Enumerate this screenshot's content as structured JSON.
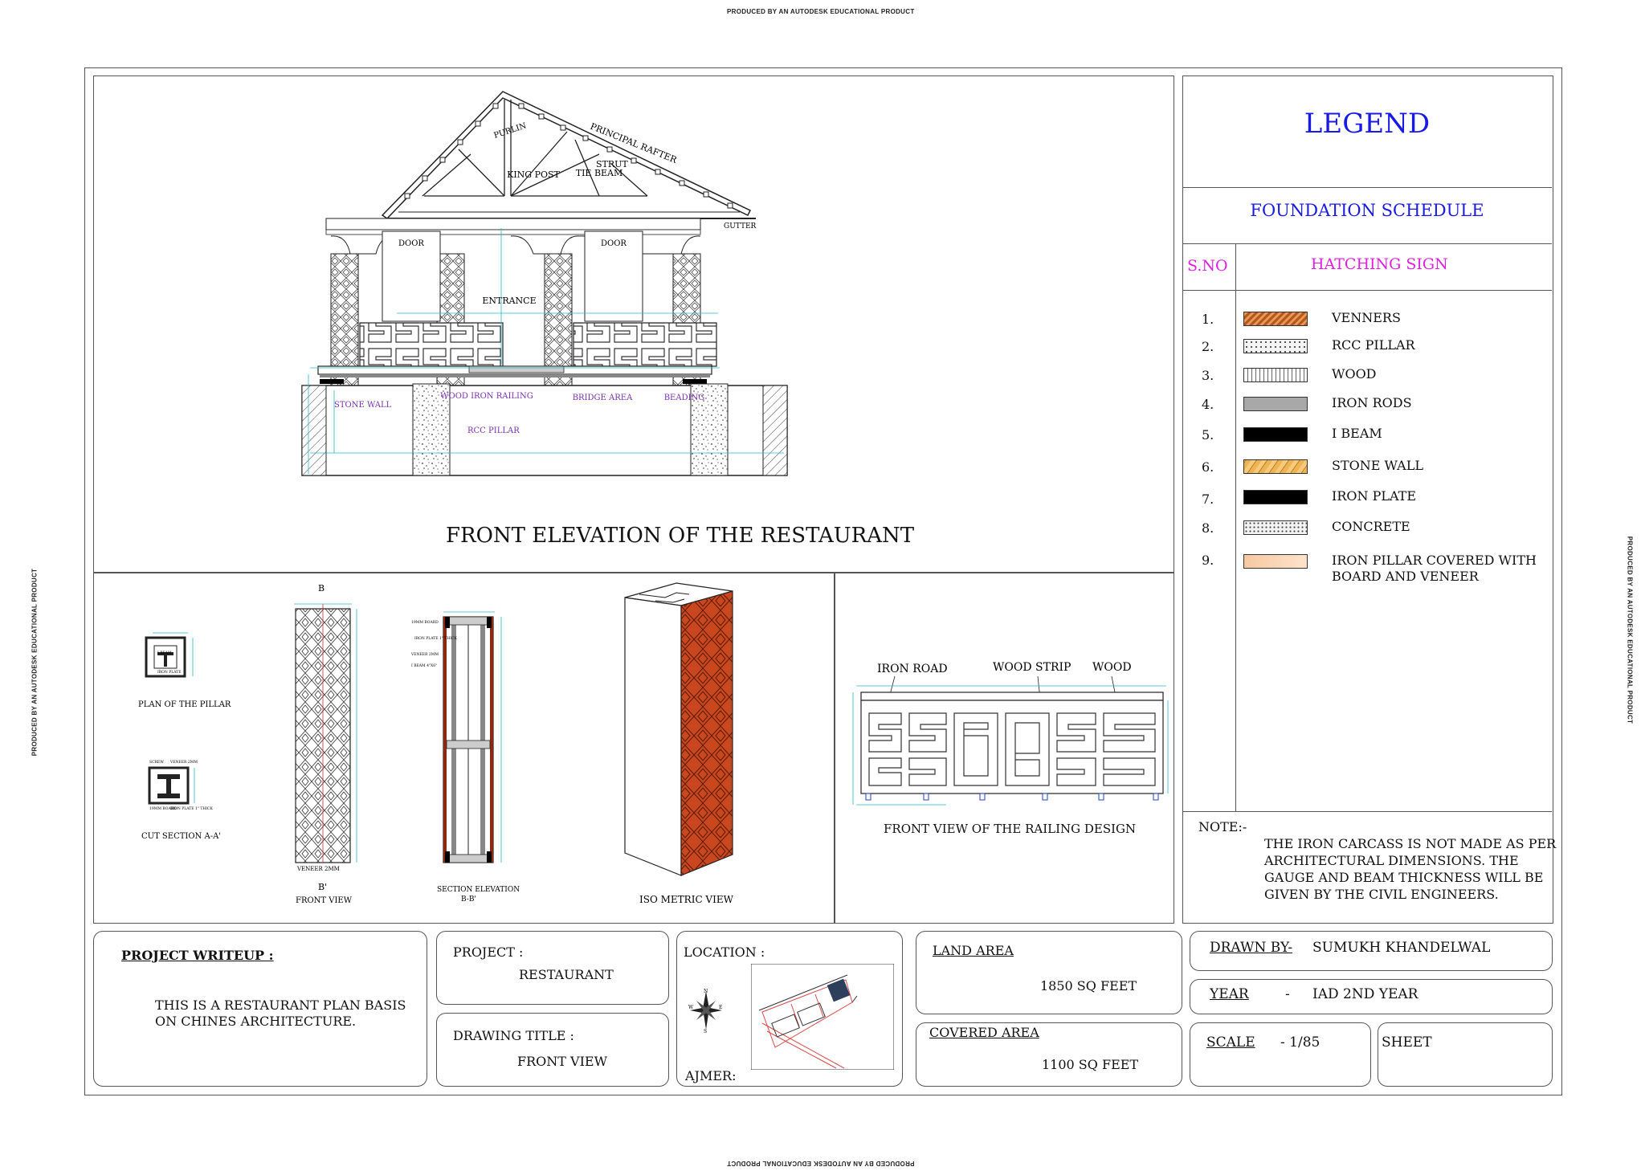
{
  "stamp": "PRODUCED BY AN AUTODESK EDUCATIONAL PRODUCT",
  "elevation": {
    "title": "FRONT ELEVATION OF THE  RESTAURANT",
    "labels": {
      "purlin": "PURLIN",
      "principal_rafter": "PRINCIPAL RAFTER",
      "tie_beam": "TIE BEAM",
      "king_post": "KING POST",
      "strut": "STRUT",
      "gutter": "GUTTER",
      "door_left": "DOOR",
      "door_right": "DOOR",
      "entrance": "ENTRANCE",
      "stone_wall": "STONE WALL",
      "wood_iron_railing": "WOOD IRON RAILING",
      "bridge_area": "BRIDGE AREA",
      "beading": "BEADING",
      "rcc_pillar": "RCC PILLAR"
    }
  },
  "details": {
    "plan_of_pillar": "PLAN OF THE PILLAR",
    "cut_section": "CUT SECTION A-A'",
    "front_view": "FRONT VIEW",
    "section_elevation_1": "SECTION ELEVATION",
    "section_elevation_2": "B-B'",
    "iso_view": "ISO METRIC VIEW",
    "veneer": "VENEER 2MM",
    "b_top": "B",
    "b_bottom": "B'",
    "plan_small": [
      "I BEAM",
      "IRON PLATE"
    ],
    "cut_small": [
      "SCREW",
      "VENEER 2MM",
      "19MM BOARD",
      "IRON PLATE 1\" THICK"
    ],
    "section_small": [
      "19MM BOARD",
      "IRON PLATE 1\" THICK",
      "VENEER 2MM",
      "I BEAM 4\"X6\""
    ]
  },
  "railing": {
    "title": "FRONT VIEW OF THE RAILING DESIGN",
    "iron_road": "IRON ROAD",
    "wood_strip": "WOOD STRIP",
    "wood": "WOOD"
  },
  "legend": {
    "title": "LEGEND",
    "subtitle": "FOUNDATION SCHEDULE",
    "col_sno": "S.NO",
    "col_hatch": "HATCHING SIGN",
    "items": [
      {
        "no": "1.",
        "name": "VENNERS",
        "swatch": "venners"
      },
      {
        "no": "2.",
        "name": "RCC PILLAR",
        "swatch": "rcc"
      },
      {
        "no": "3.",
        "name": "WOOD",
        "swatch": "wood"
      },
      {
        "no": "4.",
        "name": "IRON RODS",
        "swatch": "rods"
      },
      {
        "no": "5.",
        "name": "I BEAM",
        "swatch": "ibeam"
      },
      {
        "no": "6.",
        "name": "STONE WALL",
        "swatch": "stone"
      },
      {
        "no": "7.",
        "name": "IRON PLATE",
        "swatch": "plate"
      },
      {
        "no": "8.",
        "name": "CONCRETE",
        "swatch": "concrete"
      },
      {
        "no": "9.",
        "name": "IRON PILLAR COVERED WITH",
        "name2": "BOARD AND VENEER",
        "swatch": "pillar"
      }
    ],
    "colors": {
      "title": "#1a1ae6",
      "header": "#e020e0"
    },
    "note_label": "NOTE:-",
    "note_lines": [
      "THE IRON CARCASS IS NOT MADE AS PER",
      "ARCHITECTURAL DIMENSIONS. THE",
      "GAUGE AND BEAM THICKNESS WILL BE",
      "GIVEN BY THE CIVIL ENGINEERS."
    ]
  },
  "title_block": {
    "writeup_label": "PROJECT WRITEUP :",
    "writeup_lines": [
      "THIS IS A RESTAURANT PLAN BASIS",
      "ON CHINES ARCHITECTURE."
    ],
    "project_label": "PROJECT :",
    "project_value": "RESTAURANT",
    "drawing_title_label": "DRAWING TITLE :",
    "drawing_title_value": "FRONT VIEW",
    "location_label": "LOCATION :",
    "location_city": "AJMER:",
    "land_area_label": "LAND AREA",
    "land_area_value": "1850 SQ FEET",
    "covered_area_label": "COVERED AREA",
    "covered_area_value": "1100 SQ FEET",
    "drawn_by_label": "DRAWN BY-",
    "drawn_by_value": "SUMUKH KHANDELWAL",
    "year_label": "YEAR",
    "year_dash": "-",
    "year_value": "IAD 2ND YEAR",
    "scale_label": "SCALE",
    "scale_value": "- 1/85",
    "sheet_label": "SHEET",
    "compass": [
      "N",
      "S",
      "E",
      "W"
    ]
  }
}
